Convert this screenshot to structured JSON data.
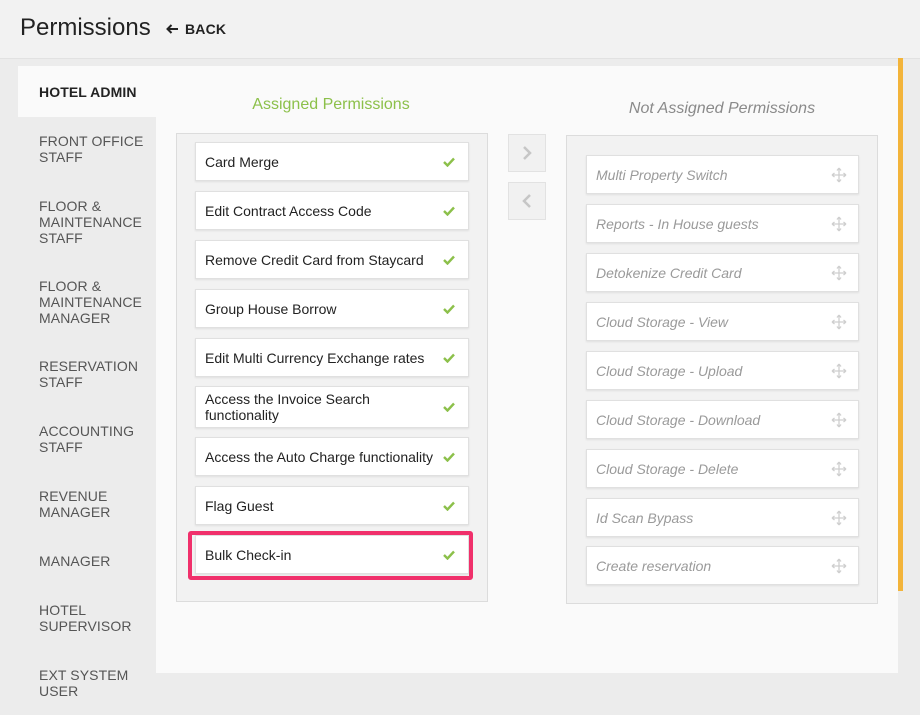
{
  "header": {
    "title": "Permissions",
    "back_label": "BACK"
  },
  "sidebar": {
    "roles": [
      {
        "label": "HOTEL ADMIN",
        "lines": [
          "HOTEL ADMIN"
        ]
      },
      {
        "label": "FRONT OFFICE STAFF",
        "lines": [
          "FRONT OFFICE",
          "STAFF"
        ]
      },
      {
        "label": "FLOOR & MAINTENANCE STAFF",
        "lines": [
          "FLOOR &",
          "MAINTENANCE",
          "STAFF"
        ]
      },
      {
        "label": "FLOOR & MAINTENANCE MANAGER",
        "lines": [
          "FLOOR &",
          "MAINTENANCE",
          "MANAGER"
        ]
      },
      {
        "label": "RESERVATION STAFF",
        "lines": [
          "RESERVATION",
          "STAFF"
        ]
      },
      {
        "label": "ACCOUNTING STAFF",
        "lines": [
          "ACCOUNTING",
          "STAFF"
        ]
      },
      {
        "label": "REVENUE MANAGER",
        "lines": [
          "REVENUE",
          "MANAGER"
        ]
      },
      {
        "label": "MANAGER",
        "lines": [
          "MANAGER"
        ]
      },
      {
        "label": "HOTEL SUPERVISOR",
        "lines": [
          "HOTEL",
          "SUPERVISOR"
        ]
      },
      {
        "label": "EXT SYSTEM USER",
        "lines": [
          "EXT SYSTEM",
          "USER"
        ]
      }
    ]
  },
  "assigned": {
    "title": "Assigned Permissions",
    "items": [
      "Card Merge",
      "Edit Contract Access Code",
      "Remove Credit Card from Staycard",
      "Group House Borrow",
      "Edit Multi Currency Exchange rates",
      "Access the Invoice Search functionality",
      "Access the Auto Charge functionality",
      "Flag Guest",
      "Bulk Check-in"
    ]
  },
  "not_assigned": {
    "title": "Not Assigned Permissions",
    "items": [
      "Multi Property Switch",
      "Reports - In House guests",
      "Detokenize Credit Card",
      "Cloud Storage - View",
      "Cloud Storage - Upload",
      "Cloud Storage - Download",
      "Cloud Storage - Delete",
      "Id Scan Bypass",
      "Create reservation"
    ]
  },
  "colors": {
    "accent": "#f3b43a",
    "assigned_title": "#8cc04a",
    "check": "#8cc04a",
    "highlight": "#f0306b"
  },
  "icons": {
    "back": "arrow-left-icon",
    "assign": "chevron-right-icon",
    "unassign": "chevron-left-icon",
    "assigned_item": "checkmark-icon",
    "not_assigned_item": "move-icon"
  }
}
